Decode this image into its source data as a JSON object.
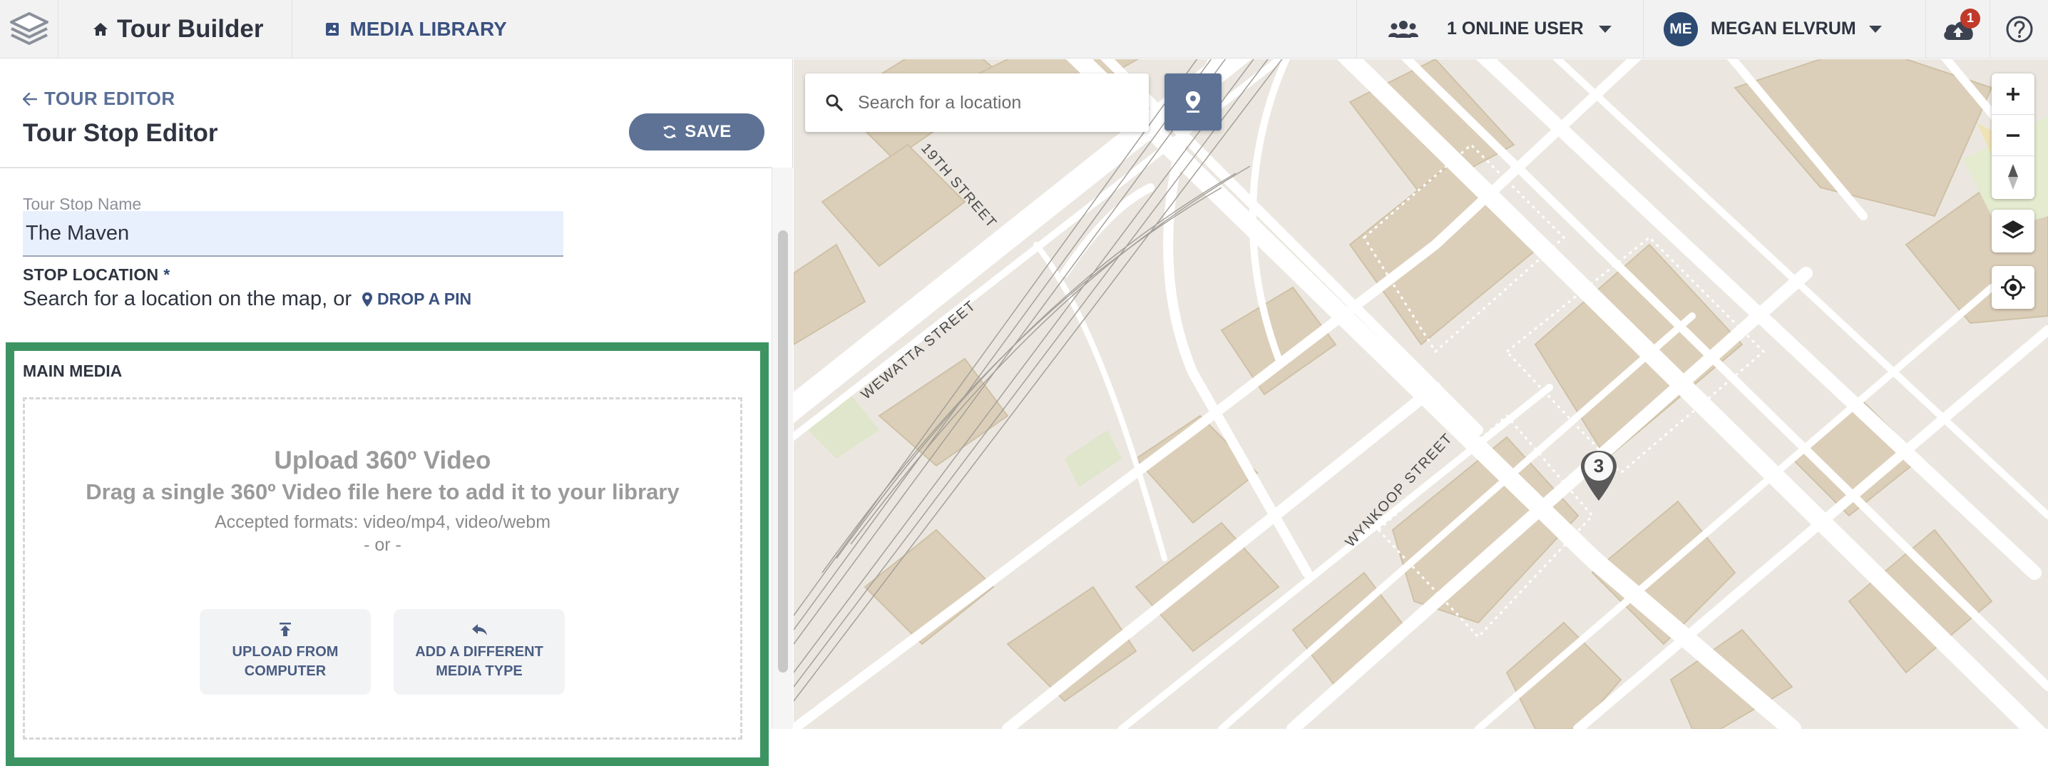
{
  "topbar": {
    "app_title": "Tour Builder",
    "media_library": "MEDIA LIBRARY",
    "online_users": "1 ONLINE USER",
    "user_initials": "ME",
    "user_name": "MEGAN ELVRUM",
    "sync_badge": "1"
  },
  "editor": {
    "back_link": "TOUR EDITOR",
    "title": "Tour Stop Editor",
    "save_label": "SAVE",
    "name_label": "Tour Stop Name",
    "name_value": "The Maven",
    "location_label": "STOP LOCATION",
    "location_required": "*",
    "location_hint": "Search for a location on the map, or",
    "drop_pin": "DROP A PIN"
  },
  "main_media": {
    "title": "MAIN MEDIA",
    "upload_title": "Upload 360º Video",
    "upload_sub": "Drag a single 360º Video file here to add it to your library",
    "formats": "Accepted formats: video/mp4, video/webm",
    "or": "- or -",
    "upload_btn": "UPLOAD FROM COMPUTER",
    "different_btn": "ADD A DIFFERENT MEDIA TYPE"
  },
  "map": {
    "search_placeholder": "Search for a location",
    "streets": [
      "19TH STREET",
      "WEWATTA STREET",
      "WYNKOOP STREET"
    ],
    "marker_number": "3"
  },
  "colors": {
    "accent": "#5e7296",
    "highlight_border": "#3d9463",
    "avatar": "#2d4a72",
    "badge": "#c0392b"
  }
}
